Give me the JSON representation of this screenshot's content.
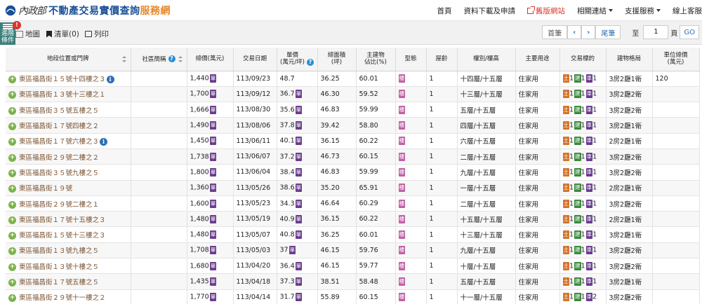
{
  "header": {
    "logo_ministry": "內政部",
    "logo_main": "不動產交易實價查詢",
    "logo_accent": "服務網",
    "nav": [
      "首頁",
      "資料下載及申請",
      "舊版網站",
      "相關連結",
      "支援服務",
      "線上客服"
    ]
  },
  "toolbar": {
    "advanced_label": "進階條件",
    "advanced_badge": "!",
    "map_label": "地圖",
    "list_label": "清單(0)",
    "print_label": "列印",
    "pager": {
      "first": "首筆",
      "prev": "‹",
      "next": "›",
      "last": "尾筆",
      "to": "至",
      "page_value": "1",
      "unit": "頁",
      "go": "GO"
    }
  },
  "table": {
    "headers": [
      "地段位置或門牌",
      "社區簡稱",
      "總價(萬元)",
      "交易日期",
      "單價\n(萬元/坪)",
      "總面積\n(坪)",
      "主建物\n佔比(%)",
      "型態",
      "屋齡",
      "樓別/樓高",
      "主要用途",
      "交易標的",
      "建物格局",
      "車位總價\n(萬元)"
    ],
    "tags": {
      "unit_price": "單",
      "type": "樓",
      "land": "土",
      "building": "建",
      "parking": "車"
    },
    "rows": [
      {
        "address": "東區福昌街１５號十四樓之３",
        "info": true,
        "total": "1,440",
        "date": "113/09/23",
        "unit": "48.7",
        "unit_tag": false,
        "area": "36.25",
        "ratio": "60.01",
        "age": "1",
        "floor": "十四層/十五層",
        "use": "住家用",
        "land": "1",
        "bldg": "1",
        "park": "1",
        "layout": "3房2廳1衛",
        "parking_price": "120"
      },
      {
        "address": "東區福昌街１３號十三樓之１",
        "info": false,
        "total": "1,700",
        "date": "113/09/12",
        "unit": "36.7",
        "unit_tag": true,
        "area": "46.30",
        "ratio": "59.52",
        "age": "1",
        "floor": "十三層/十五層",
        "use": "住家用",
        "land": "1",
        "bldg": "1",
        "park": "1",
        "layout": "3房2廳2衛",
        "parking_price": ""
      },
      {
        "address": "東區福昌街３５號五樓之５",
        "info": false,
        "total": "1,666",
        "date": "113/08/30",
        "unit": "35.6",
        "unit_tag": true,
        "area": "46.83",
        "ratio": "59.99",
        "age": "1",
        "floor": "五層/十五層",
        "use": "住家用",
        "land": "1",
        "bldg": "1",
        "park": "1",
        "layout": "3房2廳2衛",
        "parking_price": ""
      },
      {
        "address": "東區福昌街１７號四樓之２",
        "info": false,
        "total": "1,490",
        "date": "113/08/06",
        "unit": "37.8",
        "unit_tag": true,
        "area": "39.42",
        "ratio": "58.80",
        "age": "1",
        "floor": "四層/十五層",
        "use": "住家用",
        "land": "1",
        "bldg": "1",
        "park": "1",
        "layout": "3房2廳1衛",
        "parking_price": ""
      },
      {
        "address": "東區福昌街１７號六樓之３",
        "info": true,
        "total": "1,450",
        "date": "113/06/11",
        "unit": "40.1",
        "unit_tag": true,
        "area": "36.15",
        "ratio": "60.22",
        "age": "1",
        "floor": "六層/十五層",
        "use": "住家用",
        "land": "1",
        "bldg": "1",
        "park": "1",
        "layout": "2房2廳1衛",
        "parking_price": ""
      },
      {
        "address": "東區福昌街２９號二樓之２",
        "info": false,
        "total": "1,738",
        "date": "113/06/07",
        "unit": "37.2",
        "unit_tag": true,
        "area": "46.73",
        "ratio": "60.15",
        "age": "1",
        "floor": "二層/十五層",
        "use": "住家用",
        "land": "1",
        "bldg": "1",
        "park": "1",
        "layout": "3房2廳2衛",
        "parking_price": ""
      },
      {
        "address": "東區福昌街３５號九樓之５",
        "info": false,
        "total": "1,800",
        "date": "113/06/04",
        "unit": "38.4",
        "unit_tag": true,
        "area": "46.83",
        "ratio": "59.99",
        "age": "1",
        "floor": "九層/十五層",
        "use": "住家用",
        "land": "1",
        "bldg": "1",
        "park": "1",
        "layout": "3房2廳2衛",
        "parking_price": ""
      },
      {
        "address": "東區福昌街１９號",
        "info": false,
        "total": "1,360",
        "date": "113/05/26",
        "unit": "38.6",
        "unit_tag": true,
        "area": "35.20",
        "ratio": "65.91",
        "age": "1",
        "floor": "一層/十五層",
        "use": "住家用",
        "land": "1",
        "bldg": "1",
        "park": "1",
        "layout": "2房2廳1衛",
        "parking_price": ""
      },
      {
        "address": "東區福昌街２９號二樓之１",
        "info": false,
        "total": "1,600",
        "date": "113/05/23",
        "unit": "34.3",
        "unit_tag": true,
        "area": "46.64",
        "ratio": "60.29",
        "age": "1",
        "floor": "二層/十五層",
        "use": "住家用",
        "land": "1",
        "bldg": "1",
        "park": "1",
        "layout": "3房2廳2衛",
        "parking_price": ""
      },
      {
        "address": "東區福昌街１７號十五樓之３",
        "info": false,
        "total": "1,480",
        "date": "113/05/19",
        "unit": "40.9",
        "unit_tag": true,
        "area": "36.15",
        "ratio": "60.22",
        "age": "1",
        "floor": "十五層/十五層",
        "use": "住家用",
        "land": "1",
        "bldg": "1",
        "park": "1",
        "layout": "2房2廳1衛",
        "parking_price": ""
      },
      {
        "address": "東區福昌街１５號十三樓之３",
        "info": false,
        "total": "1,480",
        "date": "113/05/07",
        "unit": "40.8",
        "unit_tag": true,
        "area": "36.25",
        "ratio": "60.01",
        "age": "1",
        "floor": "十三層/十五層",
        "use": "住家用",
        "land": "1",
        "bldg": "1",
        "park": "1",
        "layout": "3房2廳1衛",
        "parking_price": ""
      },
      {
        "address": "東區福昌街１３號九樓之５",
        "info": false,
        "total": "1,708",
        "date": "113/05/03",
        "unit": "37",
        "unit_tag": true,
        "area": "46.15",
        "ratio": "59.76",
        "age": "1",
        "floor": "九層/十五層",
        "use": "住家用",
        "land": "1",
        "bldg": "1",
        "park": "1",
        "layout": "3房2廳2衛",
        "parking_price": ""
      },
      {
        "address": "東區福昌街１３號十樓之５",
        "info": false,
        "total": "1,680",
        "date": "113/04/20",
        "unit": "36.4",
        "unit_tag": true,
        "area": "46.15",
        "ratio": "59.77",
        "age": "1",
        "floor": "十層/十五層",
        "use": "住家用",
        "land": "1",
        "bldg": "1",
        "park": "1",
        "layout": "3房2廳2衛",
        "parking_price": ""
      },
      {
        "address": "東區福昌街１７號五樓之５",
        "info": false,
        "total": "1,435",
        "date": "113/04/18",
        "unit": "37.3",
        "unit_tag": true,
        "area": "38.51",
        "ratio": "58.48",
        "age": "1",
        "floor": "五層/十五層",
        "use": "住家用",
        "land": "1",
        "bldg": "1",
        "park": "1",
        "layout": "3房2廳1衛",
        "parking_price": ""
      },
      {
        "address": "東區福昌街２９號十一樓之２",
        "info": false,
        "total": "1,770",
        "date": "113/04/14",
        "unit": "31.7",
        "unit_tag": true,
        "area": "55.89",
        "ratio": "60.15",
        "age": "1",
        "floor": "十一層/十五層",
        "use": "住家用",
        "land": "1",
        "bldg": "1",
        "park": "2",
        "layout": "3房2廳2衛",
        "parking_price": ""
      }
    ]
  },
  "colors": {
    "brand_blue": "#1b4f96",
    "brand_orange": "#e8892b",
    "old_site_red": "#d9362b",
    "address_brown": "#7a5230",
    "tag_purple": "#6a3d8f",
    "tag_pink": "#c05fa5",
    "tag_land": "#d4732a",
    "tag_building": "#3a8a3d",
    "plus_green": "#7bb34a",
    "advanced_teal": "#3c7f7b"
  }
}
